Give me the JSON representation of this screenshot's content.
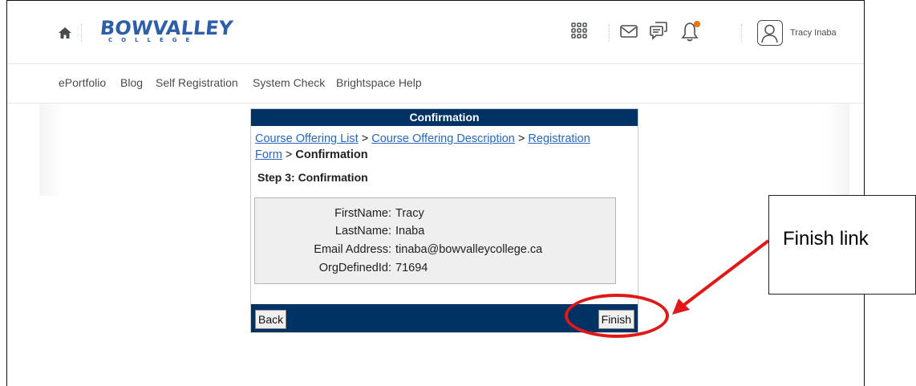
{
  "header": {
    "logo_main": "BOWVALLEY",
    "logo_sub": "COLLEGE",
    "user_name": "Tracy Inaba",
    "icons": [
      "home-icon",
      "apps-grid-icon",
      "mail-icon",
      "chat-icon",
      "bell-icon",
      "user-avatar-icon"
    ],
    "notification_dot_color": "#e87511"
  },
  "nav": {
    "items": [
      "ePortfolio",
      "Blog",
      "Self Registration",
      "System Check",
      "Brightspace Help"
    ]
  },
  "panel": {
    "title": "Confirmation",
    "breadcrumb": {
      "link1": "Course Offering List",
      "sep": ">",
      "link2": "Course Offering Description",
      "link3a": "Registration",
      "link3b": "Form",
      "current": "Confirmation"
    },
    "step_title": "Step 3: Confirmation",
    "fields": [
      {
        "label": "FirstName:",
        "value": "Tracy"
      },
      {
        "label": "LastName:",
        "value": "Inaba"
      },
      {
        "label": "Email Address:",
        "value": "tinaba@bowvalleycollege.ca"
      },
      {
        "label": "OrgDefinedId:",
        "value": "71694"
      }
    ],
    "back_label": "Back",
    "finish_label": "Finish",
    "header_color": "#003264"
  },
  "annotation": {
    "callout_text": "Finish link",
    "highlight_color": "#e01818"
  }
}
